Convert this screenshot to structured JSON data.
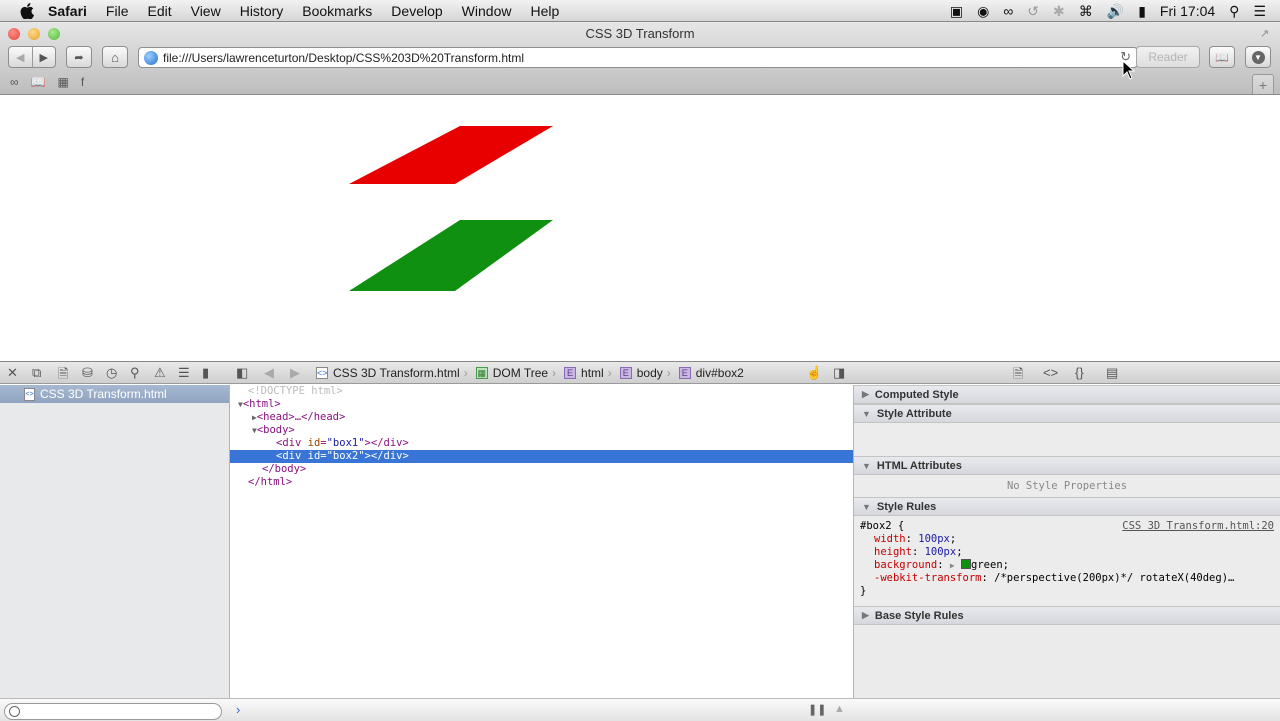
{
  "menubar": {
    "app": "Safari",
    "items": [
      "File",
      "Edit",
      "View",
      "History",
      "Bookmarks",
      "Develop",
      "Window",
      "Help"
    ],
    "status_icons": [
      "video-camera-icon",
      "record-icon",
      "creative-cloud-icon",
      "time-machine-icon",
      "bluetooth-icon",
      "wifi-icon",
      "volume-icon",
      "battery-icon"
    ],
    "clock": "Fri 17:04"
  },
  "window": {
    "title": "CSS 3D Transform",
    "url": "file:///Users/lawrenceturton/Desktop/CSS%203D%20Transform.html",
    "reader_label": "Reader",
    "bookmarks_bar": [
      "reading-list-icon",
      "bookmarks-icon",
      "top-sites-icon",
      "f"
    ],
    "new_tab_label": "+"
  },
  "page": {
    "shapes": [
      {
        "name": "box1",
        "color": "#e80000"
      },
      {
        "name": "box2",
        "color": "#109010"
      }
    ]
  },
  "inspector": {
    "resources": [
      {
        "label": "CSS 3D Transform.html"
      }
    ],
    "breadcrumbs": [
      "CSS 3D Transform.html",
      "DOM Tree",
      "html",
      "body",
      "div#box2"
    ],
    "dom": {
      "doctype": "<!DOCTYPE html>",
      "html_open": "<html>",
      "head": "<head>…</head>",
      "body_open": "<body>",
      "div1_tag": "div",
      "div1_attr": "id",
      "div1_val": "\"box1\"",
      "div2_tag": "div",
      "div2_attr": "id",
      "div2_val": "\"box2\"",
      "body_close": "</body>",
      "html_close": "</html>"
    },
    "sections": {
      "computed": "Computed Style",
      "style_attr": "Style Attribute",
      "html_attrs": "HTML Attributes",
      "no_props": "No Style Properties",
      "style_rules": "Style Rules",
      "base_rules": "Base Style Rules"
    },
    "rule": {
      "selector": "#box2 {",
      "source": "CSS 3D Transform.html:20",
      "props": [
        {
          "name": "width",
          "value": "100px"
        },
        {
          "name": "height",
          "value": "100px"
        },
        {
          "name": "background",
          "value": "green",
          "swatch": "#109010"
        },
        {
          "name": "-webkit-transform",
          "value": "/*perspective(200px)*/ rotateX(40deg)…"
        }
      ],
      "close": "}"
    },
    "console_prompt": "›"
  }
}
